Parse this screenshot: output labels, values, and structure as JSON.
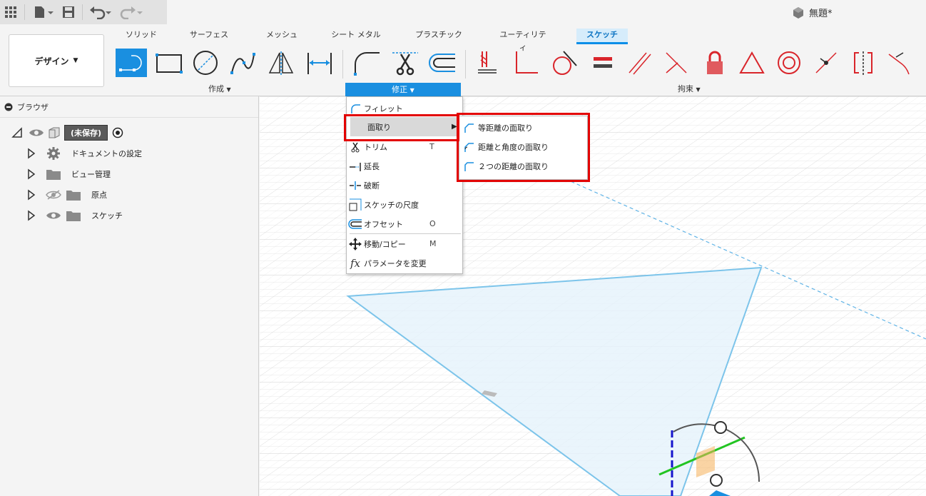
{
  "document": {
    "title": "無題*"
  },
  "ribbon": {
    "workspace_label": "デザイン",
    "tabs": [
      {
        "label": "ソリッド"
      },
      {
        "label": "サーフェス"
      },
      {
        "label": "メッシュ"
      },
      {
        "label": "シート メタル"
      },
      {
        "label": "プラスチック"
      },
      {
        "label": "ユーティリティ"
      },
      {
        "label": "スケッチ"
      }
    ],
    "groups": {
      "create": "作成",
      "modify": "修正",
      "constraints": "拘束"
    }
  },
  "browser": {
    "title": "ブラウザ",
    "root": "(未保存)",
    "items": [
      {
        "label": "ドキュメントの設定"
      },
      {
        "label": "ビュー管理"
      },
      {
        "label": "原点"
      },
      {
        "label": "スケッチ"
      }
    ]
  },
  "modify_menu": {
    "items": [
      {
        "label": "フィレット",
        "shortcut": ""
      },
      {
        "label": "面取り",
        "shortcut": ""
      },
      {
        "label": "トリム",
        "shortcut": "T"
      },
      {
        "label": "延長",
        "shortcut": ""
      },
      {
        "label": "破断",
        "shortcut": ""
      },
      {
        "label": "スケッチの尺度",
        "shortcut": ""
      },
      {
        "label": "オフセット",
        "shortcut": "O"
      },
      {
        "label": "移動/コピー",
        "shortcut": "M"
      },
      {
        "label": "パラメータを変更",
        "shortcut": ""
      }
    ]
  },
  "chamfer_submenu": {
    "items": [
      {
        "label": "等距離の面取り"
      },
      {
        "label": "距離と角度の面取り"
      },
      {
        "label": "２つの距離の面取り"
      }
    ]
  },
  "colors": {
    "accent": "#1a8fe0",
    "highlight_box": "#e30000",
    "sketch_line": "#7cc4ea",
    "constraint_red": "#d9252b"
  }
}
